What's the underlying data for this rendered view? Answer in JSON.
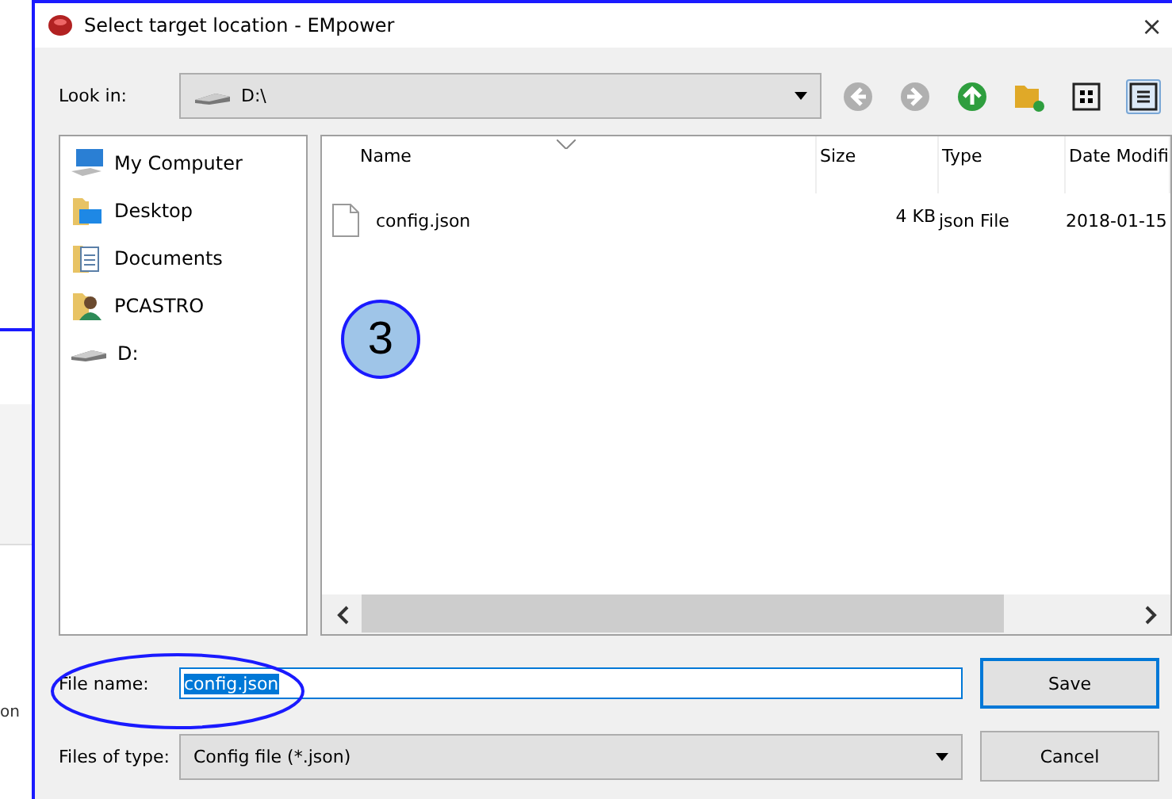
{
  "background_app": {
    "fragment": "on"
  },
  "window": {
    "title": "Select target location - EMpower",
    "close": "×"
  },
  "look_in": {
    "label": "Look in:",
    "value": "D:\\"
  },
  "toolbar": [
    {
      "kind": "back",
      "disabled": true
    },
    {
      "kind": "forward",
      "disabled": true
    },
    {
      "kind": "up",
      "disabled": false
    },
    {
      "kind": "new-folder",
      "disabled": false
    },
    {
      "kind": "icons-view",
      "selected": false
    },
    {
      "kind": "list-view",
      "selected": true
    }
  ],
  "places": [
    {
      "label": "My Computer",
      "kind": "computer"
    },
    {
      "label": "Desktop",
      "kind": "desktop"
    },
    {
      "label": "Documents",
      "kind": "documents"
    },
    {
      "label": "PCASTRO",
      "kind": "user"
    },
    {
      "label": "D:",
      "kind": "drive"
    }
  ],
  "table": {
    "columns": [
      "Name",
      "Size",
      "Type",
      "Date Modifi"
    ],
    "rows": [
      {
        "cells": [
          "config.json",
          "4 KB",
          "json File",
          "2018-01-15"
        ],
        "selected": false
      }
    ]
  },
  "annotations": [
    {
      "kind": "number",
      "text": "3"
    },
    {
      "kind": "ellipse"
    }
  ],
  "file_name": {
    "label": "File name:",
    "value": "config.json",
    "selected_text": true
  },
  "file_type": {
    "label": "Files of type:",
    "value": "Config file (*.json)"
  },
  "buttons": [
    {
      "label": "Save",
      "default": true
    },
    {
      "label": "Cancel",
      "default": false
    }
  ]
}
